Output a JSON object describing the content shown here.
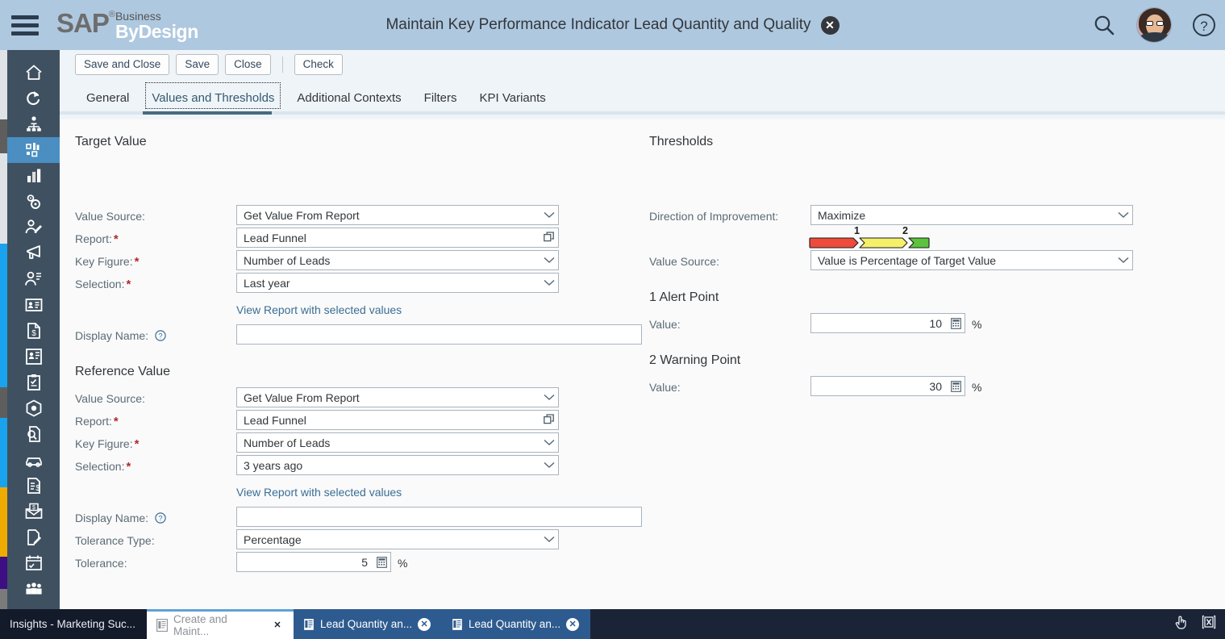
{
  "header": {
    "menu_icon": "hamburger-menu-icon",
    "logo": {
      "sap": "SAP",
      "reg": "®",
      "business": "Business",
      "bydesign": "ByDesign",
      "trademark": "·"
    },
    "title": "Maintain Key Performance Indicator Lead Quantity and Quality",
    "close_label": "✕",
    "search_icon": "search-icon",
    "help_icon": "help-icon"
  },
  "sidebar": {
    "items": [
      {
        "icon": "home-icon",
        "selected": false
      },
      {
        "icon": "refresh-arrow-icon",
        "selected": false
      },
      {
        "icon": "org-chart-icon",
        "selected": false
      },
      {
        "icon": "dashboard-icon",
        "selected": true
      },
      {
        "icon": "bar-chart-icon",
        "selected": false
      },
      {
        "icon": "gears-icon",
        "selected": false
      },
      {
        "icon": "person-edit-icon",
        "selected": false
      },
      {
        "icon": "megaphone-icon",
        "selected": false
      },
      {
        "icon": "person-list-icon",
        "selected": false
      },
      {
        "icon": "id-card-icon",
        "selected": false
      },
      {
        "icon": "invoice-document-icon",
        "selected": false
      },
      {
        "icon": "employee-payroll-icon",
        "selected": false
      },
      {
        "icon": "clipboard-check-icon",
        "selected": false
      },
      {
        "icon": "product-box-icon",
        "selected": false
      },
      {
        "icon": "document-search-icon",
        "selected": false
      },
      {
        "icon": "car-icon",
        "selected": false
      },
      {
        "icon": "financial-document-icon",
        "selected": false
      },
      {
        "icon": "invoice-mail-icon",
        "selected": false
      },
      {
        "icon": "document-edit-icon",
        "selected": false
      },
      {
        "icon": "calendar-tasks-icon",
        "selected": false
      },
      {
        "icon": "people-group-icon",
        "selected": false
      }
    ]
  },
  "toolbar": {
    "save_and_close": "Save and Close",
    "save": "Save",
    "close": "Close",
    "check": "Check"
  },
  "tabs": [
    {
      "label": "General",
      "active": false
    },
    {
      "label": "Values and Thresholds",
      "active": true
    },
    {
      "label": "Additional Contexts",
      "active": false
    },
    {
      "label": "Filters",
      "active": false
    },
    {
      "label": "KPI Variants",
      "active": false
    }
  ],
  "target_value": {
    "section_title": "Target Value",
    "value_source_label": "Value Source:",
    "value_source": "Get Value From Report",
    "report_label": "Report:",
    "report": "Lead Funnel",
    "key_figure_label": "Key Figure:",
    "key_figure": "Number of Leads",
    "selection_label": "Selection:",
    "selection": "Last year",
    "view_report_link": "View Report with selected values",
    "display_name_label": "Display Name:",
    "display_name": ""
  },
  "reference_value": {
    "section_title": "Reference Value",
    "value_source_label": "Value Source:",
    "value_source": "Get Value From Report",
    "report_label": "Report:",
    "report": "Lead Funnel",
    "key_figure_label": "Key Figure:",
    "key_figure": "Number of Leads",
    "selection_label": "Selection:",
    "selection": "3 years ago",
    "view_report_link": "View Report with selected values",
    "display_name_label": "Display Name:",
    "display_name": "",
    "tolerance_type_label": "Tolerance Type:",
    "tolerance_type": "Percentage",
    "tolerance_label": "Tolerance:",
    "tolerance": "5",
    "tolerance_unit": "%"
  },
  "thresholds": {
    "section_title": "Thresholds",
    "direction_label": "Direction of Improvement:",
    "direction": "Maximize",
    "value_source_label": "Value Source:",
    "value_source": "Value is Percentage of Target Value",
    "marker_1": "1",
    "marker_2": "2",
    "colors": {
      "alert": "#ee4b3c",
      "warning": "#f5f06a",
      "good": "#5cc43c"
    },
    "alert_point": {
      "title": "1 Alert Point",
      "value_label": "Value:",
      "value": "10",
      "unit": "%"
    },
    "warning_point": {
      "title": "2 Warning Point",
      "value_label": "Value:",
      "value": "30",
      "unit": "%"
    }
  },
  "taskbar": {
    "items": [
      {
        "label": "Insights - Marketing Suc...",
        "kind": "window",
        "closable": false
      },
      {
        "label": "Create and Maint...",
        "kind": "inactive",
        "closable": true
      },
      {
        "label": "Lead Quantity an...",
        "kind": "active",
        "closable": true
      },
      {
        "label": "Lead Quantity an...",
        "kind": "active",
        "closable": true
      }
    ],
    "close_glyph": "✕",
    "right_icons": [
      {
        "icon": "hand-pointer-icon"
      },
      {
        "icon": "close-window-icon"
      }
    ]
  }
}
